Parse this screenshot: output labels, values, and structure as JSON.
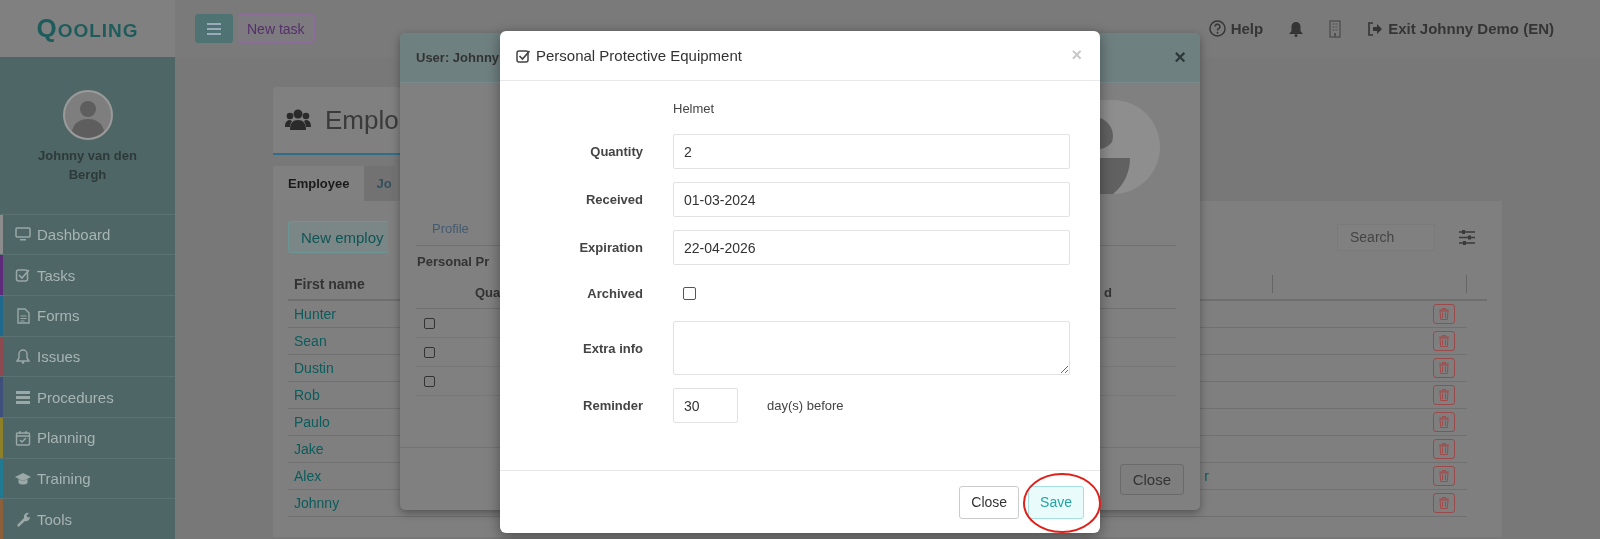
{
  "sidebar": {
    "logo": "QOOLING",
    "user_name": "Johnny van den Bergh",
    "items": [
      {
        "kind": "dashboard",
        "label": "Dashboard",
        "color": "#8c8c8c"
      },
      {
        "kind": "tasks",
        "label": "Tasks",
        "color": "#5e2a7a"
      },
      {
        "kind": "forms",
        "label": "Forms",
        "color": "#1f6a8c"
      },
      {
        "kind": "issues",
        "label": "Issues",
        "color": "#8c4a50"
      },
      {
        "kind": "procedures",
        "label": "Procedures",
        "color": "#3f4f7c"
      },
      {
        "kind": "planning",
        "label": "Planning",
        "color": "#8c8028"
      },
      {
        "kind": "training",
        "label": "Training",
        "color": "#207a94"
      },
      {
        "kind": "tools",
        "label": "Tools",
        "color": "#8a5f3a"
      }
    ]
  },
  "topbar": {
    "buttons": [
      {
        "kind": "menu"
      },
      {
        "kind": "text",
        "label": "New task"
      }
    ],
    "links": [
      {
        "kind": "help",
        "label": "Help"
      },
      {
        "kind": "bell"
      },
      {
        "kind": "building"
      },
      {
        "kind": "exit",
        "label": "Exit Johnny Demo (EN)"
      }
    ]
  },
  "page": {
    "title": "Emplo",
    "tabs": [
      {
        "label": "Employee",
        "selected": true
      },
      {
        "label": "Jo",
        "selected": false
      }
    ],
    "new_button": "New employ",
    "search": {
      "placeholder": "Search"
    },
    "table": {
      "columns": [
        "First name"
      ],
      "rows": [
        {
          "first_name": "Hunter"
        },
        {
          "first_name": "Sean"
        },
        {
          "first_name": "Dustin"
        },
        {
          "first_name": "Rob"
        },
        {
          "first_name": "Paulo"
        },
        {
          "first_name": "Jake"
        },
        {
          "first_name": "Alex",
          "column_3": "r"
        },
        {
          "first_name": "Johnny"
        }
      ]
    }
  },
  "user_modal": {
    "title": "User: Johnny",
    "close_symbol": "×",
    "tabs": [
      {
        "label": "Profile",
        "selected": false
      }
    ],
    "section": "Personal Pr",
    "columns": [
      "Qua",
      "d"
    ],
    "rows": [
      {
        "checked": false
      },
      {
        "checked": false
      },
      {
        "checked": false
      }
    ],
    "close": "Close"
  },
  "ppe_modal": {
    "title": "Personal Protective Equipment",
    "close_symbol": "×",
    "item": "Helmet",
    "fields": [
      {
        "kind": "text",
        "label": "Quantity",
        "value": "2"
      },
      {
        "kind": "text",
        "label": "Received",
        "value": "01-03-2024"
      },
      {
        "kind": "text",
        "label": "Expiration",
        "value": "22-04-2026"
      },
      {
        "kind": "checkbox",
        "label": "Archived",
        "checked": false
      },
      {
        "kind": "textarea",
        "label": "Extra info"
      },
      {
        "kind": "number",
        "label": "Reminder",
        "value": "30",
        "suffix": "day(s) before"
      }
    ],
    "buttons": [
      {
        "kind": "default",
        "label": "Close"
      },
      {
        "kind": "primary",
        "label": "Save"
      }
    ]
  }
}
